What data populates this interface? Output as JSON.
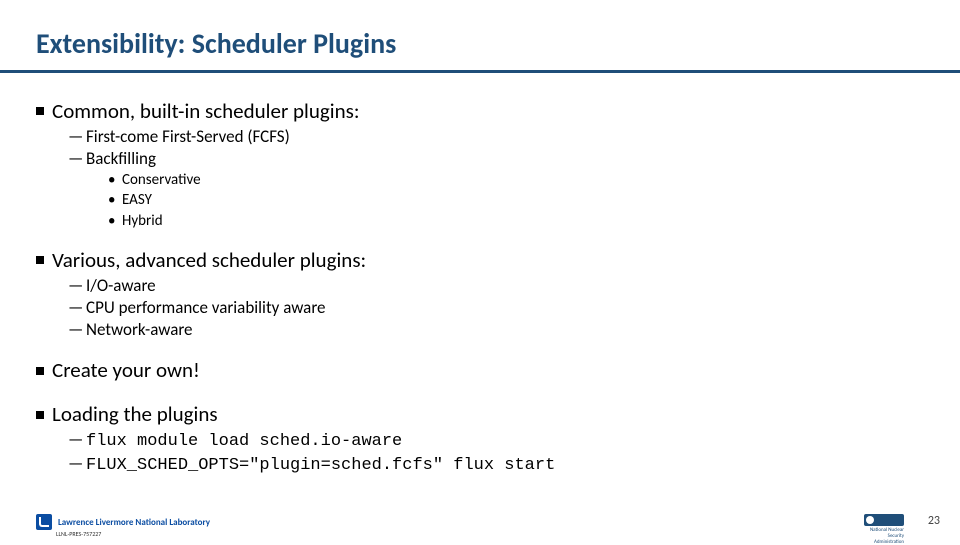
{
  "title": "Extensibility: Scheduler Plugins",
  "section1": {
    "heading": "Common, built-in scheduler plugins:",
    "items": {
      "a": "First-come First-Served (FCFS)",
      "b": "Backfilling",
      "b_sub": {
        "i": "Conservative",
        "ii": "EASY",
        "iii": "Hybrid"
      }
    }
  },
  "section2": {
    "heading": "Various, advanced scheduler plugins:",
    "items": {
      "a": "I/O-aware",
      "b": "CPU performance variability aware",
      "c": "Network-aware"
    }
  },
  "section3": {
    "heading": "Create your own!"
  },
  "section4": {
    "heading": "Loading the plugins",
    "items": {
      "a": "flux module load sched.io-aware",
      "b": "FLUX_SCHED_OPTS=\"plugin=sched.fcfs\" flux start"
    }
  },
  "footer": {
    "llnl": "Lawrence Livermore National Laboratory",
    "llnl_id": "LLNL-PRES-757227",
    "nnsa": "National Nuclear Security Administration",
    "page": "23"
  }
}
